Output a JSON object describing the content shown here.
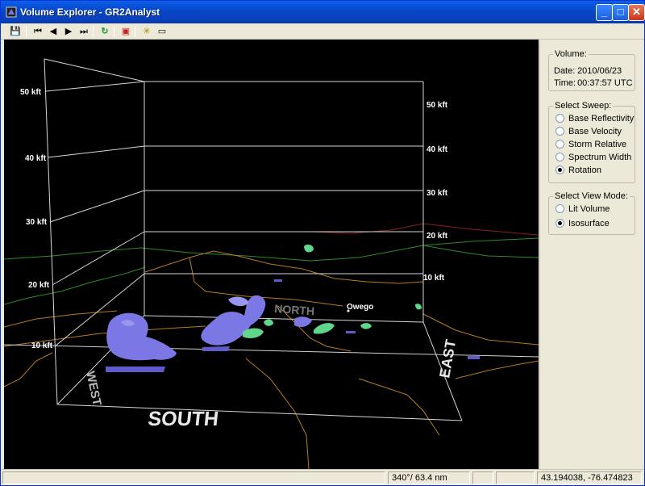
{
  "window": {
    "title": "Volume Explorer - GR2Analyst",
    "minimize": "_",
    "maximize": "□",
    "close": "✕"
  },
  "toolbar": {
    "save": "💾",
    "first": "⏮",
    "prev": "◀",
    "next": "▶",
    "last": "⏭",
    "refresh": "↻",
    "cube": "▣",
    "settings": "✳",
    "screen": "▭"
  },
  "viewport": {
    "altitudes_left": [
      "50 kft",
      "40 kft",
      "30 kft",
      "20 kft",
      "10 kft"
    ],
    "altitudes_right": [
      "50 kft",
      "40 kft",
      "30 kft",
      "20 kft",
      "10 kft"
    ],
    "directions": {
      "south": "SOUTH",
      "east": "EAST",
      "north": "NORTH",
      "west": "WEST"
    },
    "city": "Owego"
  },
  "panel": {
    "volume": {
      "title": "Volume:",
      "date_label": "Date:",
      "date": "2010/06/23",
      "time_label": "Time:",
      "time": "00:37:57 UTC"
    },
    "sweep": {
      "title": "Select Sweep:",
      "options": [
        "Base Reflectivity",
        "Base Velocity",
        "Storm Relative",
        "Spectrum Width",
        "Rotation"
      ],
      "selected": "Rotation"
    },
    "view_mode": {
      "title": "Select View Mode:",
      "options": [
        "Lit Volume",
        "Isosurface"
      ],
      "selected": "Isosurface"
    }
  },
  "status": {
    "cell1": "",
    "cell2": "",
    "view": "340°/ 63.4 nm",
    "cell4": "",
    "cell5": "",
    "coords": "43.194038, -76.474823"
  },
  "colors": {
    "isosurface_purple": "#7b78e6",
    "isosurface_green": "#5fd68a",
    "county_lines": "#b87a1e",
    "state_lines": "#2e8b2e"
  }
}
